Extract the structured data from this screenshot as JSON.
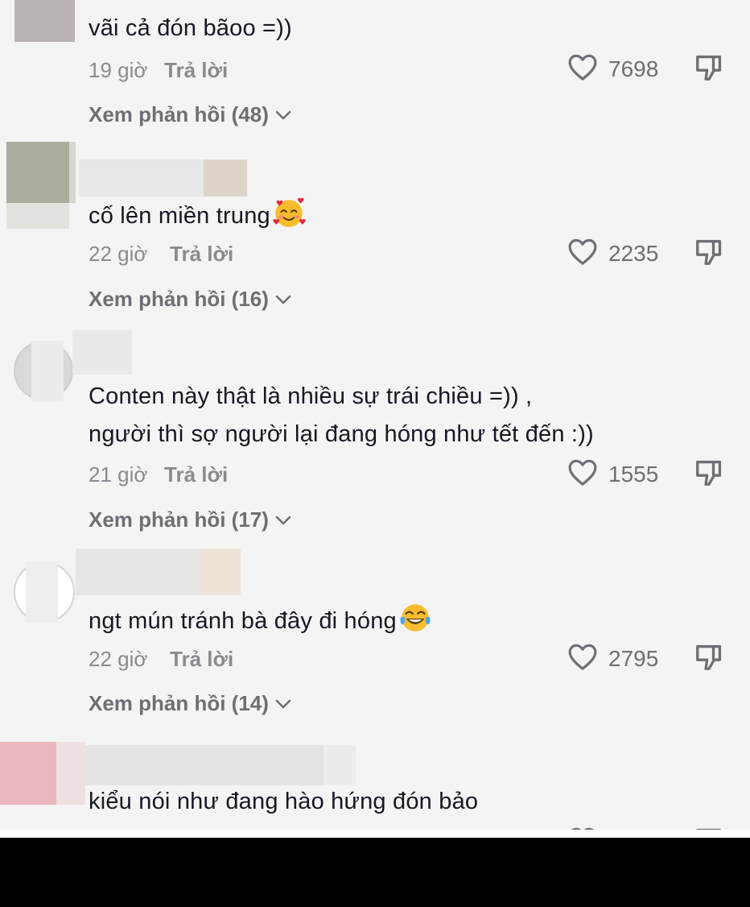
{
  "comments": [
    {
      "text": "vãi cả đón bãoo =))",
      "time": "19 giờ",
      "reply": "Trả lời",
      "likes": "7698",
      "view_replies": "Xem phản hồi (48)"
    },
    {
      "text": "cố lên miền trung",
      "time": "22 giờ",
      "reply": "Trả lời",
      "likes": "2235",
      "view_replies": "Xem phản hồi (16)",
      "emoji": "smiling-face-with-hearts-emoji"
    },
    {
      "text_line1": "Conten này thật là nhiều sự trái chiều =)) ,",
      "text_line2": "người thì sợ người lại đang hóng như tết đến :))",
      "time": "21 giờ",
      "reply": "Trả lời",
      "likes": "1555",
      "view_replies": "Xem phản hồi (17)"
    },
    {
      "text": "ngt mún tránh bà đây đi hóng",
      "time": "22 giờ",
      "reply": "Trả lời",
      "likes": "2795",
      "view_replies": "Xem phản hồi (14)",
      "emoji": "tears-of-joy-emoji"
    },
    {
      "text": "kiểu nói như đang hào hứng đón bảo"
    }
  ],
  "colors": {
    "background": "#f4f4f4",
    "text": "#161823",
    "meta": "#8a8b91",
    "icon": "#6e6f75"
  }
}
